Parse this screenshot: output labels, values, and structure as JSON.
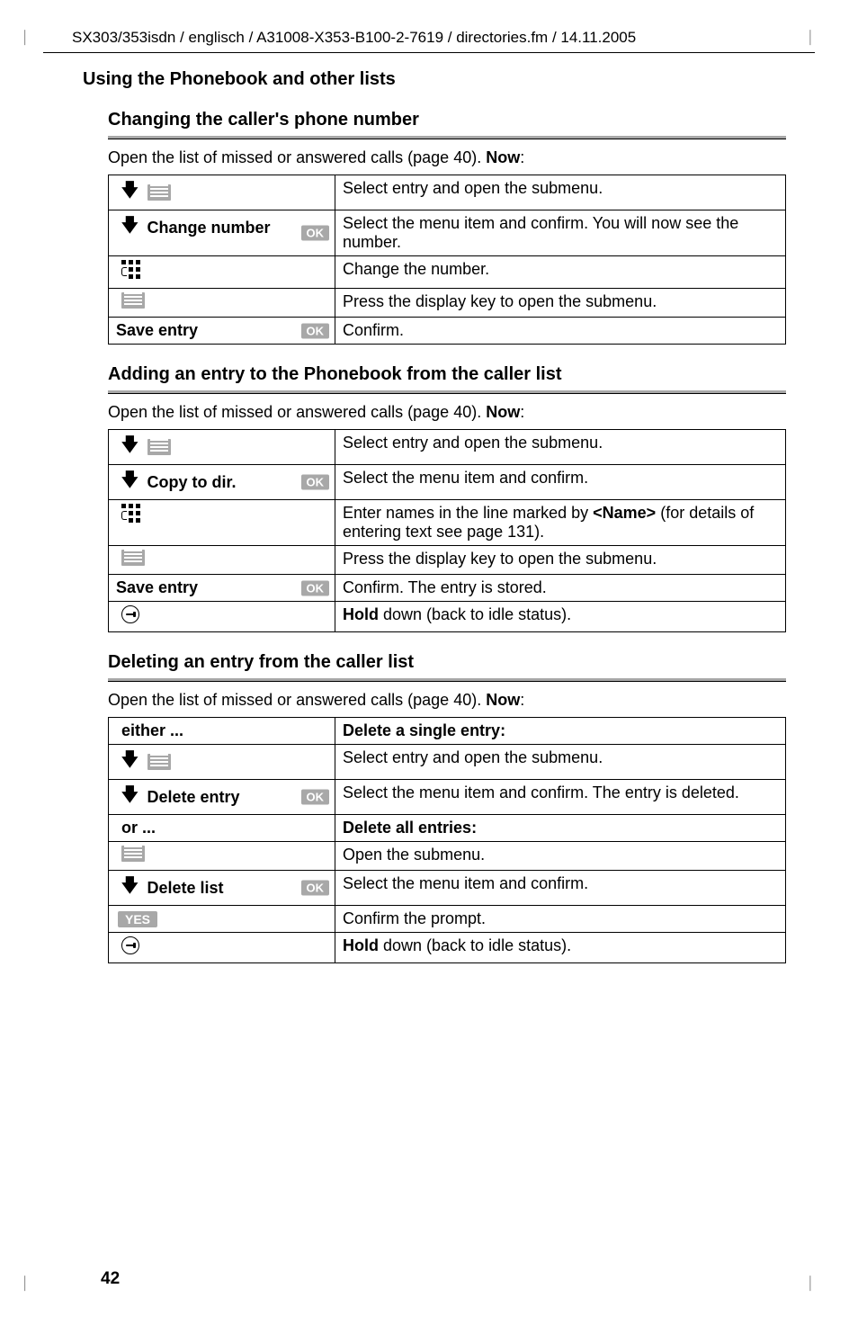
{
  "header": "SX303/353isdn / englisch / A31008-X353-B100-2-7619 / directories.fm / 14.11.2005",
  "running_title": "Using the Phonebook and other lists",
  "page_number": "42",
  "ok_label": "OK",
  "yes_label": "YES",
  "sections": {
    "s1": {
      "title": "Changing the caller's phone number",
      "intro_prefix": "Open the list of missed or answered calls (page 40). ",
      "intro_bold": "Now",
      "intro_suffix": ":",
      "rows": {
        "r1_right": "Select entry and open the submenu.",
        "r2_label": "Change number",
        "r2_right": "Select the menu item and confirm. You will now see the number.",
        "r3_right": "Change the number.",
        "r4_right": "Press the display key to open the submenu.",
        "r5_label": "Save entry",
        "r5_right": "Confirm."
      }
    },
    "s2": {
      "title": "Adding an entry to the Phonebook from the caller list",
      "intro_prefix": "Open the list of missed or answered calls (page 40). ",
      "intro_bold": "Now",
      "intro_suffix": ":",
      "rows": {
        "r1_right": "Select entry and open the submenu.",
        "r2_label": "Copy to dir.",
        "r2_right": "Select the menu item and confirm.",
        "r3_right_a": "Enter names in the line marked by ",
        "r3_right_b": "<Name>",
        "r3_right_c": " (for details of entering text see page 131).",
        "r4_right": "Press the display key to open the submenu.",
        "r5_label": "Save entry",
        "r5_right": "Confirm. The entry is stored.",
        "r6_right_bold": "Hold",
        "r6_right_rest": " down (back to idle status)."
      }
    },
    "s3": {
      "title": "Deleting an entry from the caller list",
      "intro_prefix": "Open the list of missed or answered calls (page 40). ",
      "intro_bold": "Now",
      "intro_suffix": ":",
      "rows": {
        "h1_left": "either ...",
        "h1_right": "Delete a single entry:",
        "r1_right": "Select entry and open the submenu.",
        "r2_label": "Delete entry",
        "r2_right": "Select the menu item and confirm. The entry is deleted.",
        "h2_left": "or ...",
        "h2_right": "Delete all entries:",
        "r3_right": "Open the submenu.",
        "r4_label": "Delete list",
        "r4_right": "Select the menu item and confirm.",
        "r5_right": "Confirm the prompt.",
        "r6_right_bold": "Hold",
        "r6_right_rest": " down (back to idle status)."
      }
    }
  }
}
